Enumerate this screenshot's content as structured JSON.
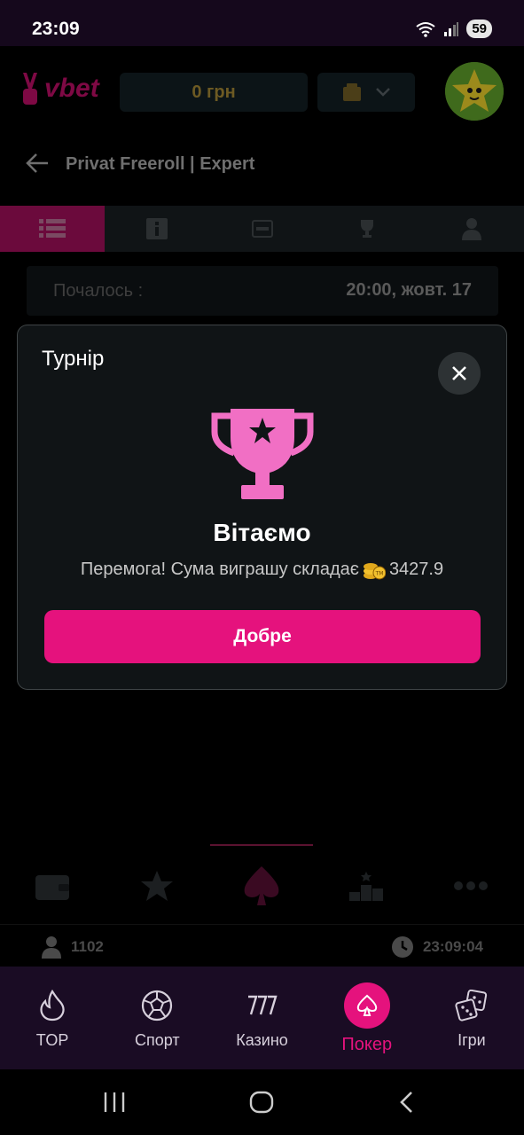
{
  "status_bar": {
    "time": "23:09",
    "battery": "59"
  },
  "header": {
    "logo_text": "vbet",
    "balance": "0 грн"
  },
  "page": {
    "title": "Privat Freeroll | Expert"
  },
  "tabs": [
    {
      "icon": "list-icon",
      "active": true
    },
    {
      "icon": "info-icon"
    },
    {
      "icon": "ticket-icon"
    },
    {
      "icon": "trophy-icon"
    },
    {
      "icon": "user-icon"
    }
  ],
  "tournament": {
    "started_label": "Почалось :",
    "started_value": "20:00, жовт. 17"
  },
  "info_bar": {
    "players": "1102",
    "clock": "23:09:04"
  },
  "bottom_nav": [
    {
      "label": "TOP",
      "icon": "flame-icon"
    },
    {
      "label": "Спорт",
      "icon": "soccer-ball-icon"
    },
    {
      "label": "Казино",
      "icon": "slots-777-icon"
    },
    {
      "label": "Покер",
      "icon": "spade-icon",
      "active": true
    },
    {
      "label": "Ігри",
      "icon": "dice-icon"
    }
  ],
  "modal": {
    "title": "Турнір",
    "heading": "Вітаємо",
    "message_prefix": "Перемога! Сума виграшу складає",
    "amount": "3427.9",
    "button": "Добре"
  },
  "colors": {
    "accent": "#e5127d",
    "modal_bg": "#101416",
    "nav_bg": "#1a0c24"
  }
}
